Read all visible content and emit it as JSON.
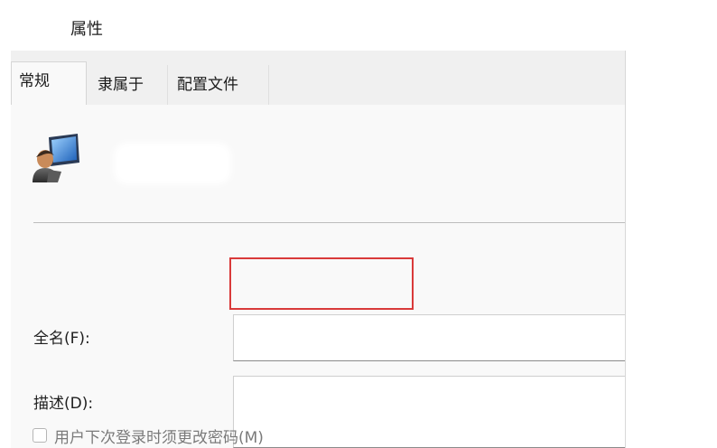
{
  "window": {
    "title": "属性"
  },
  "tabs": [
    {
      "label": "常规",
      "active": true
    },
    {
      "label": "隶属于",
      "active": false
    },
    {
      "label": "配置文件",
      "active": false
    }
  ],
  "general": {
    "user_icon": "user-computer-icon",
    "full_name": {
      "label": "全名(F):",
      "value": ""
    },
    "description": {
      "label": "描述(D):",
      "value": ""
    },
    "must_change_password": {
      "label": "用户下次登录时须更改密码(M)",
      "checked": false
    }
  },
  "colors": {
    "highlight": "#d93a3a",
    "dialog_bg": "#f9f9f9",
    "tabstrip_bg": "#f0f0f0"
  }
}
